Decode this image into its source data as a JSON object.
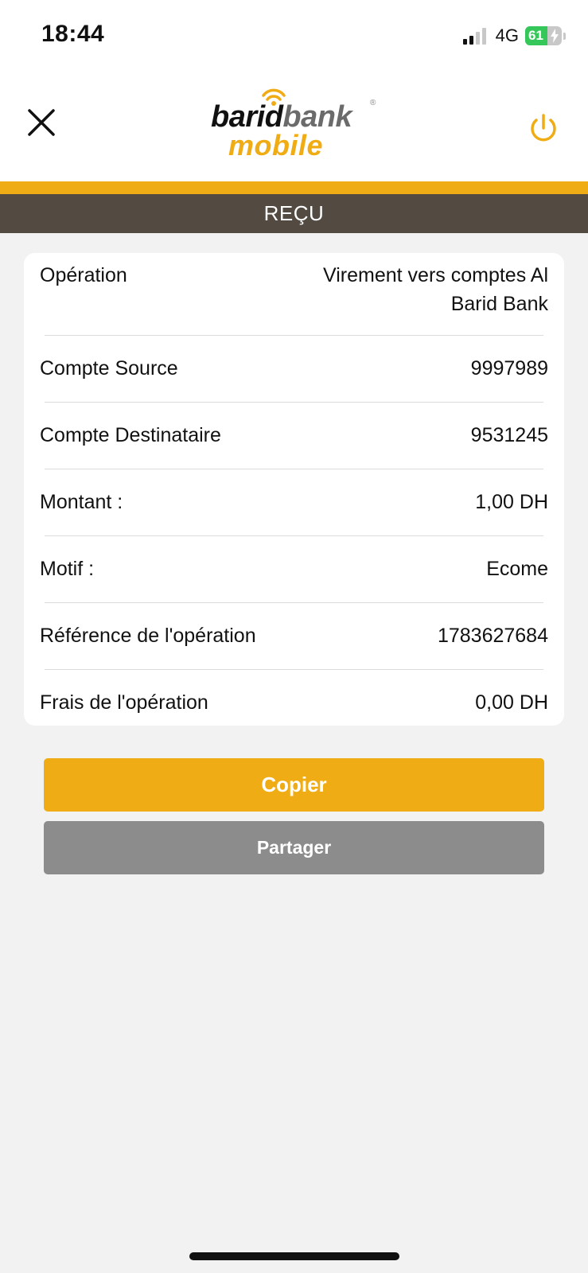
{
  "status_bar": {
    "time": "18:44",
    "network": "4G",
    "battery_percent": "61",
    "battery_level": 0.61,
    "signal_bars_active": 2,
    "signal_bars_total": 4,
    "battery_color": "#35c759"
  },
  "header": {
    "close_icon": "close-icon",
    "power_icon": "power-icon",
    "logo": {
      "word1": "barid",
      "word2": "bank",
      "word3": "mobile",
      "registered": "®"
    },
    "accent_color": "#f0ac14"
  },
  "title_bar": {
    "title": "REÇU",
    "bg_color": "#534a41"
  },
  "receipt": {
    "rows": [
      {
        "label": "Opération",
        "value_line1": "Virement vers comptes Al",
        "value_line2": "Barid Bank"
      },
      {
        "label": "Compte Source",
        "value": "9997989"
      },
      {
        "label": "Compte Destinataire",
        "value": "9531245"
      },
      {
        "label": "Montant :",
        "value": "1,00 DH"
      },
      {
        "label": "Motif :",
        "value": "Ecome"
      },
      {
        "label": "Référence de l'opération",
        "value": "1783627684"
      },
      {
        "label": "Frais de l'opération",
        "value": "0,00 DH"
      }
    ]
  },
  "actions": {
    "copy_label": "Copier",
    "share_label": "Partager",
    "copy_color": "#f0ac14",
    "share_color": "#8c8c8c"
  }
}
